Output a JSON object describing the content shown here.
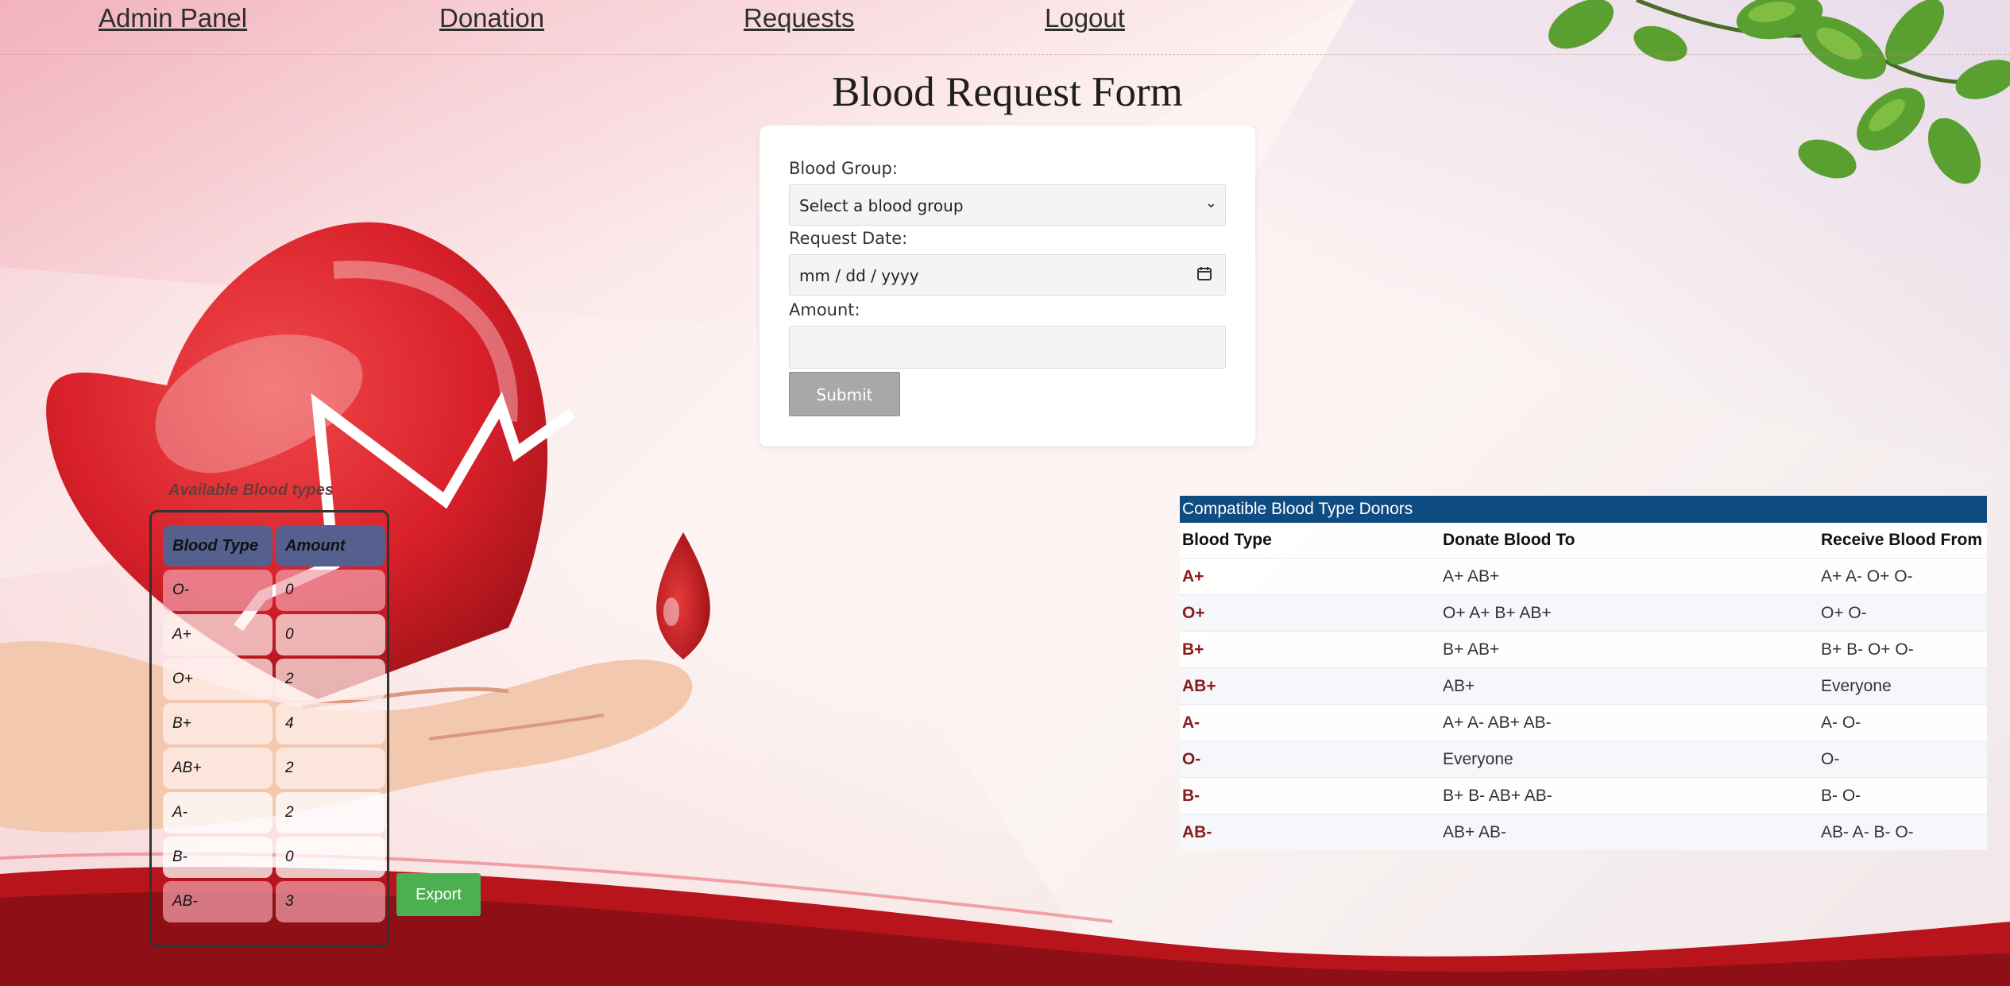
{
  "nav": {
    "admin_panel": "Admin Panel",
    "donation": "Donation",
    "requests": "Requests",
    "logout": "Logout"
  },
  "form": {
    "title": "Blood Request Form",
    "blood_group_label": "Blood Group:",
    "blood_group_value": "Select a blood group",
    "request_date_label": "Request Date:",
    "request_date_value": "mm / dd / yyyy",
    "amount_label": "Amount:",
    "amount_value": "",
    "submit_label": "Submit"
  },
  "available": {
    "title": "Available Blood types",
    "headers": [
      "Blood Type",
      "Amount"
    ],
    "rows": [
      {
        "type": "O-",
        "amount": "0"
      },
      {
        "type": "A+",
        "amount": "0"
      },
      {
        "type": "O+",
        "amount": "2"
      },
      {
        "type": "B+",
        "amount": "4"
      },
      {
        "type": "AB+",
        "amount": "2"
      },
      {
        "type": "A-",
        "amount": "2"
      },
      {
        "type": "B-",
        "amount": "0"
      },
      {
        "type": "AB-",
        "amount": "3"
      }
    ],
    "export_label": "Export"
  },
  "compat": {
    "caption": "Compatible Blood Type Donors",
    "headers": [
      "Blood Type",
      "Donate Blood To",
      "Receive Blood From"
    ],
    "rows": [
      {
        "type": "A+",
        "donate": "A+ AB+",
        "receive": "A+ A- O+ O-"
      },
      {
        "type": "O+",
        "donate": "O+ A+ B+ AB+",
        "receive": "O+ O-"
      },
      {
        "type": "B+",
        "donate": "B+ AB+",
        "receive": "B+ B- O+ O-"
      },
      {
        "type": "AB+",
        "donate": "AB+",
        "receive": "Everyone"
      },
      {
        "type": "A-",
        "donate": "A+ A- AB+ AB-",
        "receive": "A- O-"
      },
      {
        "type": "O-",
        "donate": "Everyone",
        "receive": "O-"
      },
      {
        "type": "B-",
        "donate": "B+ B- AB+ AB-",
        "receive": "B- O-"
      },
      {
        "type": "AB-",
        "donate": "AB+ AB-",
        "receive": "AB- A- B- O-"
      }
    ]
  },
  "colors": {
    "nav_text": "#2e2e2e",
    "caption_bg": "#0f4c81",
    "export_bg": "#4caf50",
    "submit_bg": "#a8a8a8",
    "blood_red": "#d8202a",
    "table_header_bg": "#55608f"
  },
  "icons": [
    "chevron-down-icon",
    "calendar-icon",
    "heart-illustration",
    "blood-drop-illustration",
    "leaves-illustration"
  ]
}
